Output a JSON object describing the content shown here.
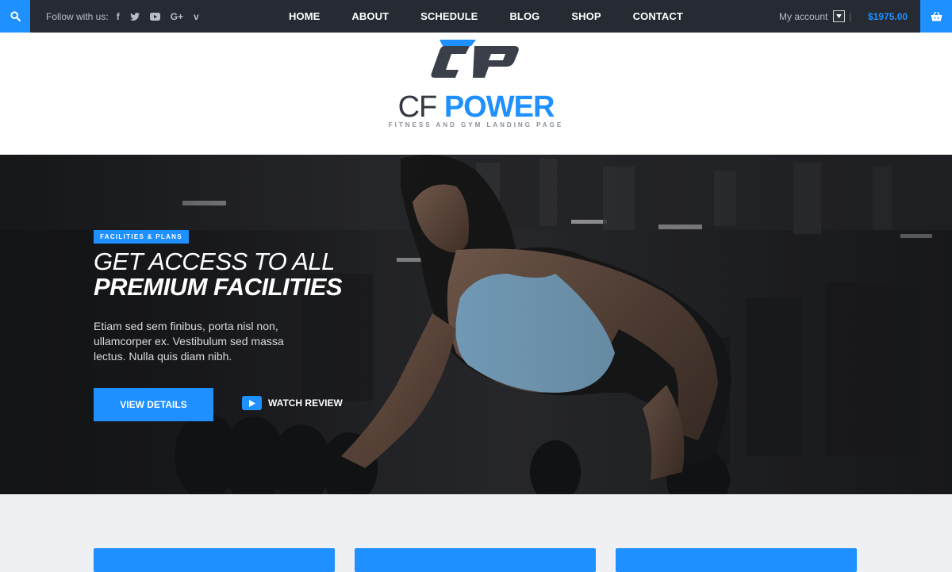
{
  "topbar": {
    "follow_label": "Follow with us:",
    "social": [
      {
        "icon": "facebook-icon",
        "glyph": "f"
      },
      {
        "icon": "twitter-icon",
        "glyph": "t"
      },
      {
        "icon": "youtube-icon",
        "glyph": "▶"
      },
      {
        "icon": "google-plus-icon",
        "glyph": "G+"
      },
      {
        "icon": "vimeo-icon",
        "glyph": "v"
      }
    ],
    "nav": [
      "HOME",
      "ABOUT",
      "SCHEDULE",
      "BLOG",
      "SHOP",
      "CONTACT"
    ],
    "account_label": "My account",
    "cart_total": "$1975.00"
  },
  "logo": {
    "name_part1": "CF ",
    "name_part2": "POWER",
    "tagline": "FITNESS AND GYM LANDING PAGE"
  },
  "hero": {
    "badge": "FACILITIES & PLANS",
    "title_line1": "GET ACCESS TO ALL",
    "title_line2": "PREMIUM FACILITIES",
    "description": "Etiam sed sem finibus, porta nisl non, ullamcorper ex. Vestibulum sed massa lectus. Nulla quis diam nibh.",
    "primary_button": "VIEW DETAILS",
    "secondary_button": "WATCH REVIEW"
  },
  "colors": {
    "accent": "#1e90ff",
    "topbar_bg": "#262a33",
    "section_bg": "#eef0f4"
  }
}
